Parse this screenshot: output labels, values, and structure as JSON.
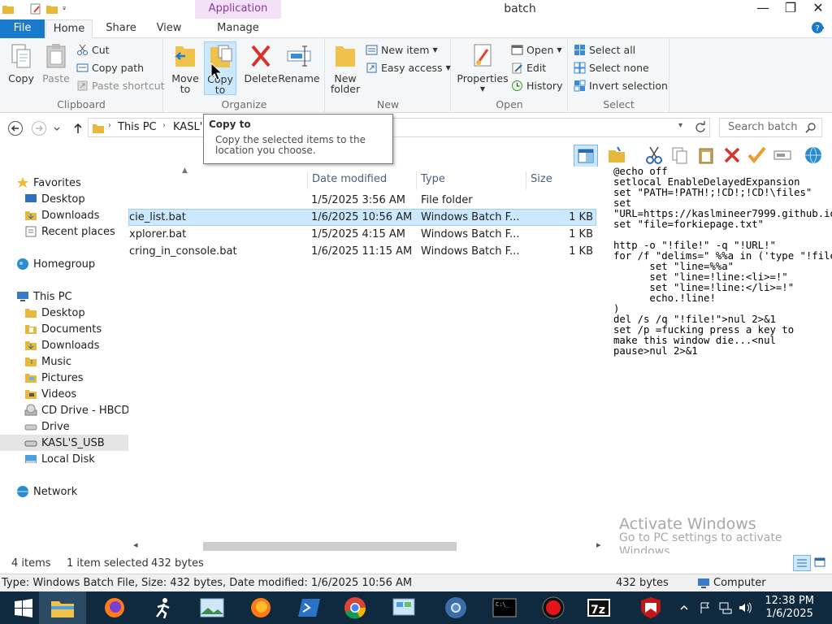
{
  "window": {
    "title": "batch",
    "context_tab": "Application Tools"
  },
  "ribbon_tabs": {
    "file": "File",
    "home": "Home",
    "share": "Share",
    "view": "View",
    "manage": "Manage"
  },
  "clipboard": {
    "copy": "Copy",
    "paste": "Paste",
    "cut": "Cut",
    "copy_path": "Copy path",
    "paste_shortcut": "Paste shortcut",
    "label": "Clipboard"
  },
  "organize": {
    "move_to_1": "Move",
    "move_to_2": "to",
    "copy_to_1": "Copy",
    "copy_to_2": "to",
    "delete": "Delete",
    "rename": "Rename",
    "label": "Organize"
  },
  "new": {
    "new_folder_1": "New",
    "new_folder_2": "folder",
    "new_item": "New item",
    "easy_access": "Easy access",
    "label": "New"
  },
  "open": {
    "properties": "Properties",
    "open": "Open",
    "edit": "Edit",
    "history": "History",
    "label": "Open"
  },
  "select": {
    "select_all": "Select all",
    "select_none": "Select none",
    "invert": "Invert selection",
    "label": "Select"
  },
  "address": {
    "crumb1": "This PC",
    "crumb2": "KASL'S",
    "search_placeholder": "Search batch"
  },
  "tooltip": {
    "title": "Copy to",
    "body": "Copy the selected items to the location you choose."
  },
  "nav": {
    "favorites": "Favorites",
    "desktop": "Desktop",
    "downloads": "Downloads",
    "recent": "Recent places",
    "homegroup": "Homegroup",
    "thispc": "This PC",
    "pc_desktop": "Desktop",
    "documents": "Documents",
    "pc_downloads": "Downloads",
    "music": "Music",
    "pictures": "Pictures",
    "videos": "Videos",
    "cddrive": "CD Drive - HBCD_",
    "drive": "Drive",
    "usb": "KASL'S_USB",
    "localdisk": "Local Disk",
    "network": "Network"
  },
  "columns": {
    "date": "Date modified",
    "type": "Type",
    "size": "Size"
  },
  "files": [
    {
      "name": "",
      "date": "1/5/2025 3:56 AM",
      "type": "File folder",
      "size": ""
    },
    {
      "name": "cie_list.bat",
      "date": "1/6/2025 10:56 AM",
      "type": "Windows Batch F...",
      "size": "1 KB"
    },
    {
      "name": "xplorer.bat",
      "date": "1/5/2025 4:15 AM",
      "type": "Windows Batch F...",
      "size": "1 KB"
    },
    {
      "name": "cring_in_console.bat",
      "date": "1/6/2025 11:15 AM",
      "type": "Windows Batch F...",
      "size": "1 KB"
    }
  ],
  "preview_code": "@echo off\nsetlocal EnableDelayedExpansion\nset \"PATH=!PATH!;!CD!;!CD!\\files\"\nset\n\"URL=https://kaslmineer7999.github.io/\"\nset \"file=forkiepage.txt\"\n\nhttp -o \"!file!\" -q \"!URL!\"\nfor /f \"delims=\" %%a in ('type \"!file!\"^|find \"li>\"') do (\n      set \"line=%%a\"\n      set \"line=!line:<li>=!\"\n      set \"line=!line:</li>=!\"\n      echo.!line!\n)\ndel /s /q \"!file!\">nul 2>&1\nset /p =fucking press a key to\nmake this window die...<nul\npause>nul 2>&1",
  "watermark": {
    "title": "Activate Windows",
    "sub1": "Go to PC settings to activate",
    "sub2": "Windows."
  },
  "status": {
    "count": "4 items",
    "selected": "1 item selected",
    "bytes": "432 bytes"
  },
  "info": {
    "detail": "Type: Windows Batch File, Size: 432 bytes, Date modified: 1/6/2025 10:56 AM",
    "size": "432 bytes",
    "location": "Computer"
  },
  "clock": {
    "time": "12:38 PM",
    "date": "1/6/2025"
  }
}
